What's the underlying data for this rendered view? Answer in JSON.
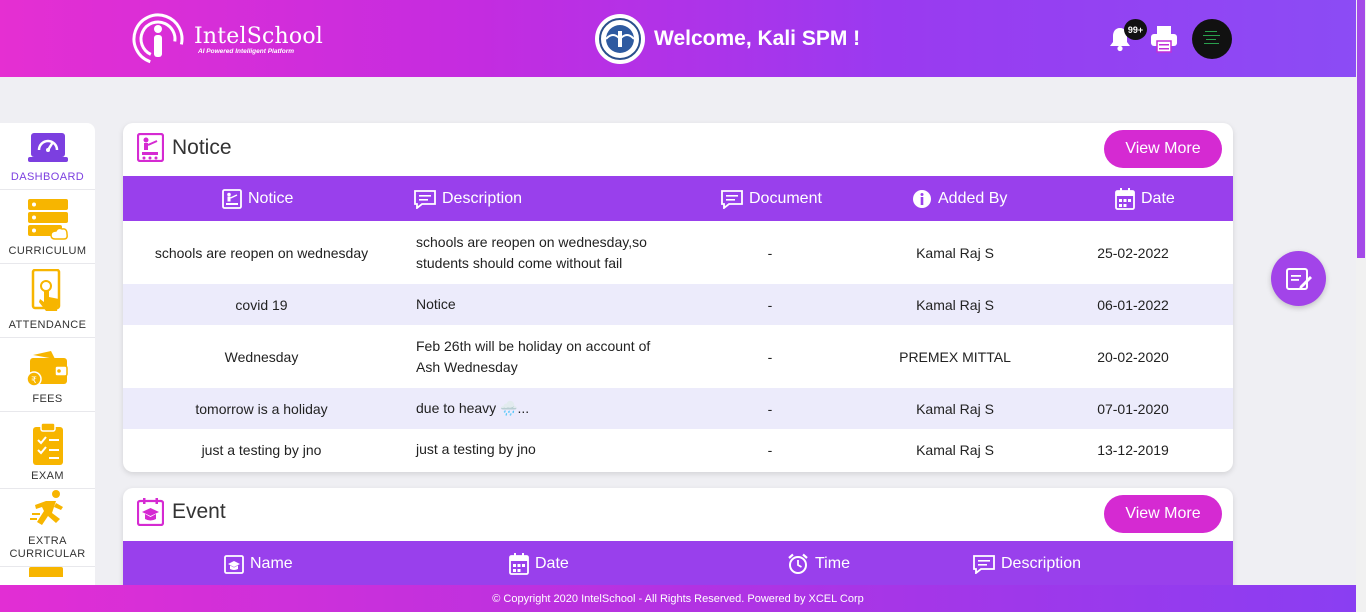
{
  "header": {
    "logo_name": "IntelSchool",
    "logo_tagline": "AI Powered Intelligent Platform",
    "welcome": "Welcome, Kali SPM !",
    "notification_count": "99+"
  },
  "sidebar": {
    "items": [
      {
        "label": "DASHBOARD",
        "icon": "dashboard-icon",
        "active": true
      },
      {
        "label": "CURRICULUM",
        "icon": "curriculum-icon"
      },
      {
        "label": "ATTENDANCE",
        "icon": "attendance-icon"
      },
      {
        "label": "FEES",
        "icon": "fees-wallet-icon"
      },
      {
        "label": "EXAM",
        "icon": "exam-clipboard-icon"
      },
      {
        "label": "EXTRA CURRICULAR",
        "icon": "runner-icon"
      }
    ]
  },
  "notice": {
    "title": "Notice",
    "view_more": "View More",
    "columns": [
      "Notice",
      "Description",
      "Document",
      "Added By",
      "Date"
    ],
    "rows": [
      {
        "notice": "schools are reopen on wednesday",
        "description": "schools are reopen on wednesday,so students should come without fail",
        "document": "-",
        "added_by": "Kamal Raj S",
        "date": "25-02-2022"
      },
      {
        "notice": "covid 19",
        "description": "Notice",
        "document": "-",
        "added_by": "Kamal Raj S",
        "date": "06-01-2022"
      },
      {
        "notice": "Wednesday",
        "description": "Feb 26th will be holiday on account of Ash Wednesday",
        "document": "-",
        "added_by": "PREMEX MITTAL",
        "date": "20-02-2020"
      },
      {
        "notice": "tomorrow is a holiday",
        "description": "due to heavy 🌧️...",
        "document": "-",
        "added_by": "Kamal Raj S",
        "date": "07-01-2020"
      },
      {
        "notice": "just a testing by jno",
        "description": "just a testing by jno",
        "document": "-",
        "added_by": "Kamal Raj S",
        "date": "13-12-2019"
      }
    ]
  },
  "event": {
    "title": "Event",
    "view_more": "View More",
    "columns": [
      "Name",
      "Date",
      "Time",
      "Description"
    ]
  },
  "footer": {
    "copyright": "© Copyright 2020 IntelSchool - All Rights Reserved. Powered by XCEL Corp"
  },
  "colors": {
    "accent": "#9940ec",
    "brand_pink": "#d52ad2",
    "icon_yellow": "#f7b500"
  }
}
